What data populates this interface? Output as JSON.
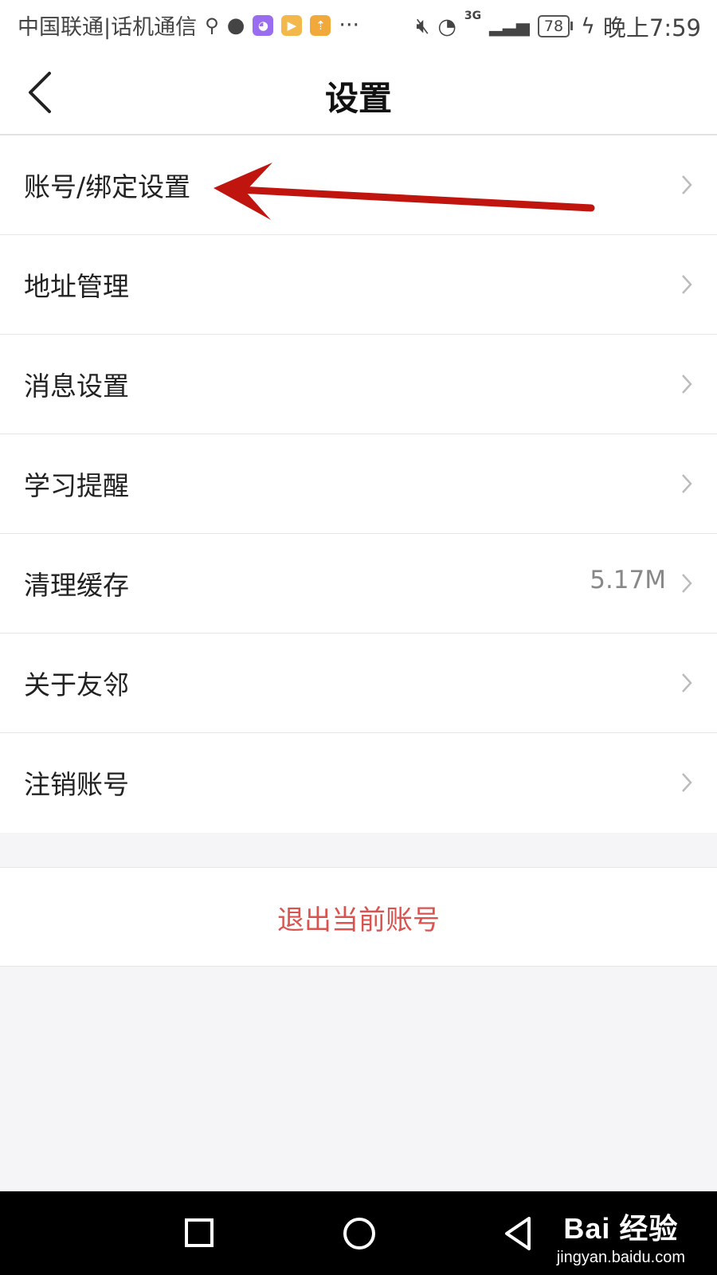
{
  "statusbar": {
    "carrier": "中国联通|话机通信",
    "network": "3G",
    "battery": "78",
    "time": "晚上7:59"
  },
  "header": {
    "title": "设置"
  },
  "settings": {
    "items": [
      {
        "label": "账号/绑定设置",
        "value": ""
      },
      {
        "label": "地址管理",
        "value": ""
      },
      {
        "label": "消息设置",
        "value": ""
      },
      {
        "label": "学习提醒",
        "value": ""
      },
      {
        "label": "清理缓存",
        "value": "5.17M"
      },
      {
        "label": "关于友邻",
        "value": ""
      },
      {
        "label": "注销账号",
        "value": ""
      }
    ]
  },
  "logout": {
    "label": "退出当前账号",
    "color": "#d9534f"
  },
  "annotation": {
    "arrow_color": "#c0140f"
  },
  "watermark": {
    "logo": "Bai 经验",
    "url": "jingyan.baidu.com"
  }
}
